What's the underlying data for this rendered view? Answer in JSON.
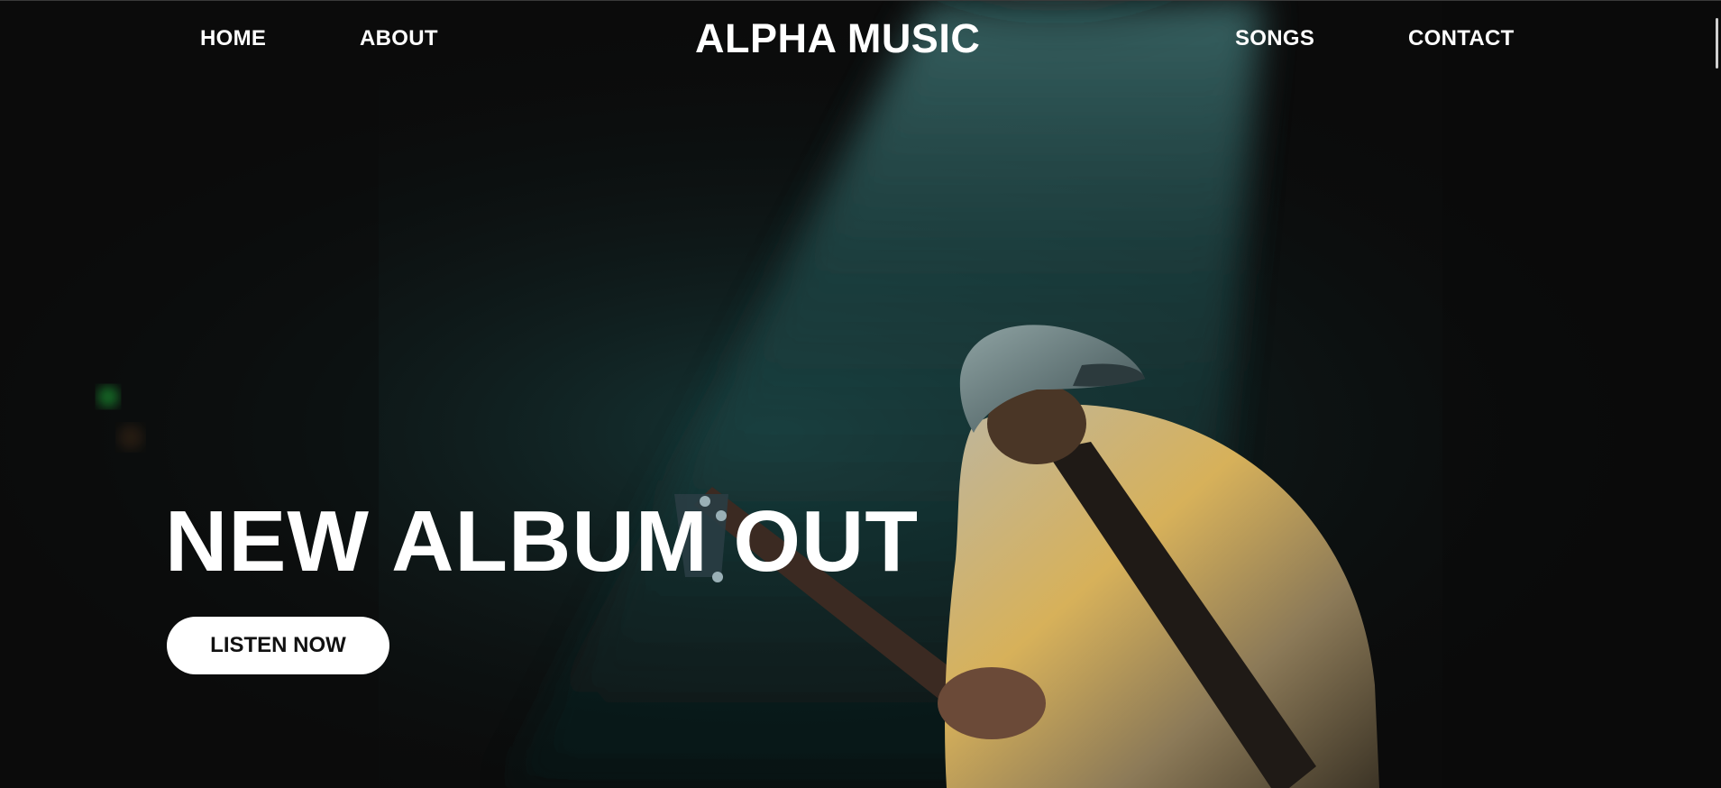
{
  "nav": {
    "home_label": "HOME",
    "about_label": "ABOUT",
    "songs_label": "SONGS",
    "contact_label": "CONTACT"
  },
  "brand": {
    "title": "ALPHA MUSIC"
  },
  "hero": {
    "headline": "NEW ALBUM OUT",
    "cta_label": "LISTEN NOW",
    "image_semantic": "guitarist-on-stage-spotlight-photo"
  },
  "colors": {
    "background": "#0b0b0b",
    "text": "#ffffff",
    "spotlight": "#2f6a6a",
    "button_bg": "#ffffff",
    "button_text": "#111111"
  }
}
